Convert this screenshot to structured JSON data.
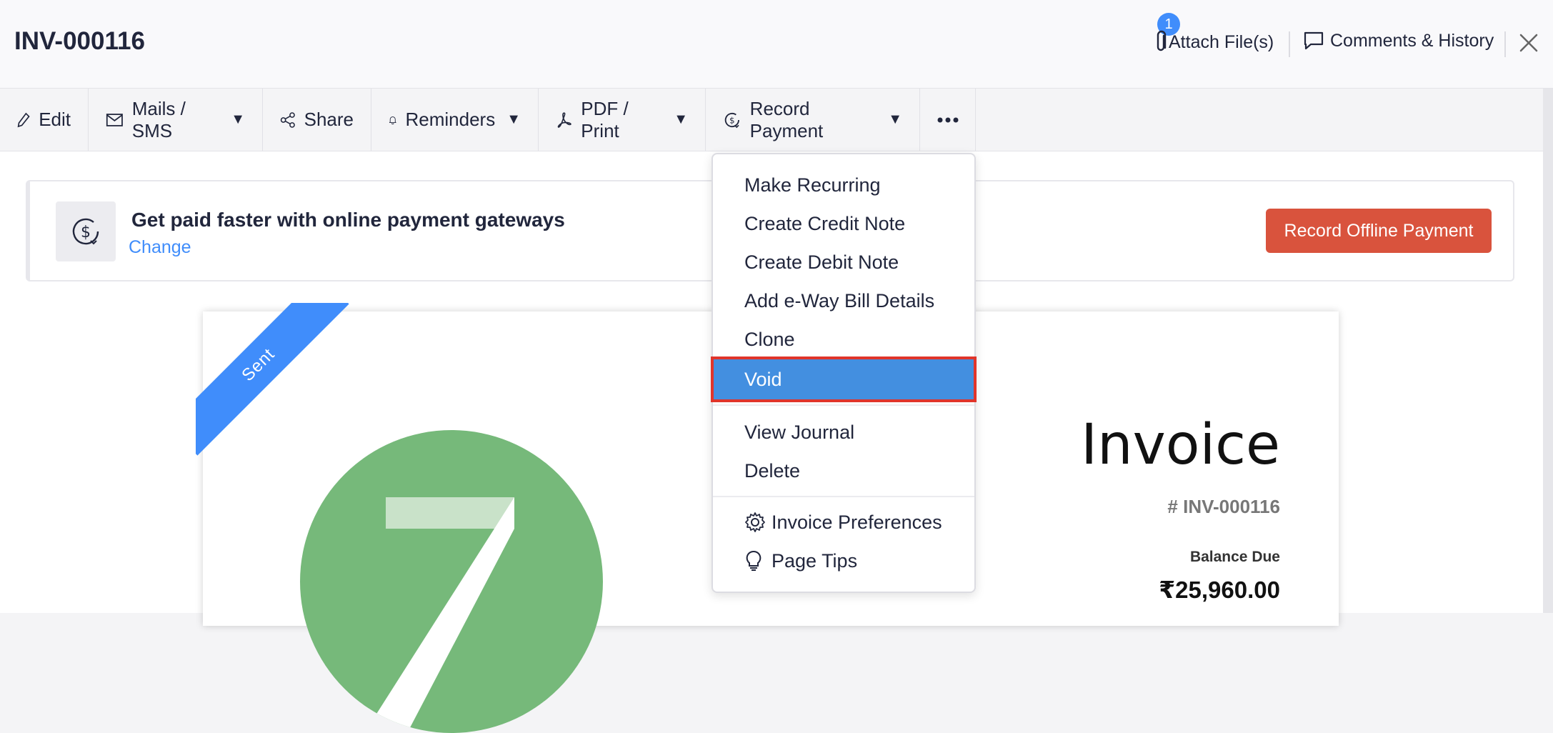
{
  "header": {
    "title": "INV-000116",
    "attach_badge": "1",
    "attach_label": "Attach File(s)",
    "comments_label": "Comments & History"
  },
  "toolbar": {
    "edit": "Edit",
    "mails": "Mails / SMS",
    "share": "Share",
    "reminders": "Reminders",
    "pdf": "PDF / Print",
    "record_payment": "Record Payment",
    "caret": "▼"
  },
  "banner": {
    "title": "Get paid faster with online payment gateways",
    "link": "Change",
    "button": "Record Offline Payment"
  },
  "menu": {
    "items": [
      "Make Recurring",
      "Create Credit Note",
      "Create Debit Note",
      "Add e-Way Bill Details",
      "Clone",
      "Void",
      "View Journal",
      "Delete",
      "Invoice Preferences",
      "Page Tips"
    ],
    "selected": "Void"
  },
  "document": {
    "status_ribbon": "Sent",
    "heading": "Invoice",
    "number": "# INV-000116",
    "balance_label": "Balance Due",
    "balance_value": "₹25,960.00"
  },
  "colors": {
    "accent": "#408dfb",
    "primary_button": "#d9533d",
    "highlight_outline": "#e0352b",
    "logo_green": "#76b97a"
  }
}
